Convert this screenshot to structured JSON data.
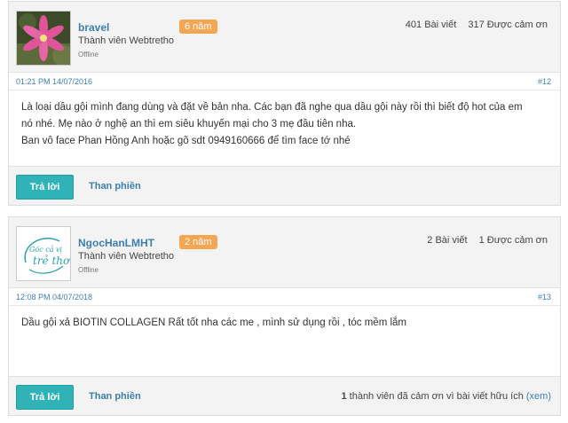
{
  "posts": [
    {
      "user": {
        "name": "bravel",
        "badge": "6 năm",
        "title": "Thành viên Webtretho",
        "status": "Offline",
        "posts": "401 Bài viết",
        "thanks": "317 Được cảm ơn"
      },
      "date": "01:21 PM 14/07/2016",
      "number": "#12",
      "lines": [
        "Là loại dầu gội mình đang dùng và đặt về bản nha. Các bạn đã nghe qua dầu gội này rồi thì biết độ hot của em",
        "nó nhé. Mẹ nào ở nghệ an thì em siêu khuyến mại cho 3 mẹ đầu tiên nha.",
        "Ban vô face Phan Hồng Anh hoặc gõ sdt 0949160666 để tìm face tớ nhé"
      ],
      "reply_label": "Trả lời",
      "complain_label": "Than phiền"
    },
    {
      "user": {
        "name": "NgocHanLMHT",
        "badge": "2 năm",
        "title": "Thành viên Webtretho",
        "status": "Offline",
        "posts": "2 Bài viết",
        "thanks": "1 Được cảm ơn",
        "avatar_logo_text": "Góc cả vị trẻ thơ"
      },
      "date": "12:08 PM 04/07/2018",
      "number": "#13",
      "lines": [
        "Dầu gội xả BIOTIN COLLAGEN Rất tốt nha các me , mình sử dụng rồi , tóc mềm lắm"
      ],
      "reply_label": "Trả lời",
      "complain_label": "Than phiền",
      "thanks_note": {
        "count": "1",
        "text": " thành viên đã cảm ơn vì bài viết hữu ích ",
        "link": "(xem)"
      }
    }
  ],
  "colors": {
    "link": "#3e7fb0",
    "badge": "#f4a652",
    "reply_button": "#2fb3b7",
    "panel": "#f3f3f3"
  },
  "icons": {
    "avatar1": "pink-flower-photo",
    "avatar2": "webtretho-logo"
  }
}
